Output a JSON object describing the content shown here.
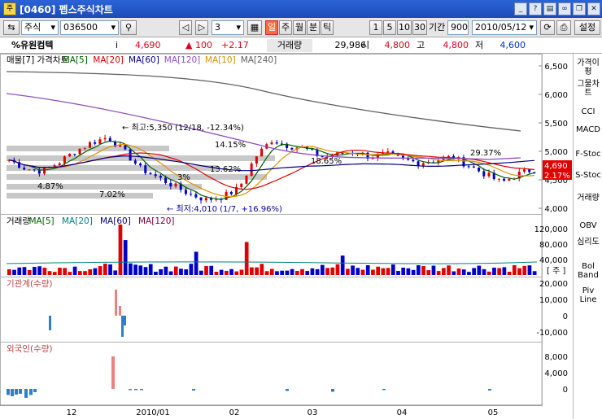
{
  "window": {
    "title": "[0460] 펩스주식차트",
    "app_icon": "주",
    "buttons": [
      "↓",
      "?",
      "?",
      "?",
      "?",
      "✕"
    ]
  },
  "toolbar": {
    "market": "주식",
    "code": "036500",
    "count": "3",
    "period_buttons": [
      "일",
      "주",
      "월",
      "분",
      "틱"
    ],
    "active_period": "일",
    "interval_buttons": [
      "1",
      "5",
      "10",
      "30"
    ],
    "range_label": "기간",
    "range_value": "900",
    "date": "2010/05/12",
    "settings_label": "설정"
  },
  "quote": {
    "name": "%유원컴텍",
    "i_label": "i",
    "price": "4,690",
    "change": "▲ 100",
    "rate": "+2.17",
    "volume_label": "거래량",
    "volume": "29,986",
    "open_label": "시",
    "open": "4,800",
    "high_label": "고",
    "high": "4,800",
    "low_label": "저",
    "low": "4,600"
  },
  "price_panel": {
    "legend": [
      "매물[7]",
      "가격차트",
      "MA[5]",
      "MA[20]",
      "MA[60]",
      "MA[120]",
      "MA[10]",
      "MA[240]"
    ],
    "legend_colors": [
      "#000000",
      "#000000",
      "#006000",
      "#e00000",
      "#000080",
      "#9050c0",
      "#e09000",
      "#606060"
    ],
    "y_ticks": [
      "6,500",
      "6,000",
      "5,500",
      "5,000",
      "4,500",
      "4,000"
    ],
    "max_label": "최고:5,350 (12/18, -12.34%)",
    "min_label": "최저:4,010 (1/7, +16.96%)",
    "pct_labels": [
      "14.15%",
      "29.37%",
      "4.87%",
      "7.02%",
      "13.62%",
      "3%",
      "18.65%"
    ],
    "last_price": "4,690",
    "last_rate": "2.17%"
  },
  "volume_panel": {
    "legend": [
      "거래량",
      "MA[5]",
      "MA[20]",
      "MA[60]",
      "MA[120]"
    ],
    "legend_colors": [
      "#000000",
      "#006000",
      "#008080",
      "#000080",
      "#800040"
    ],
    "y_ticks": [
      "120,000",
      "80,000",
      "40,000"
    ],
    "unit": "[ 주 ]"
  },
  "inst_panel": {
    "legend": "기관계(수량)",
    "y_ticks": [
      "20,000",
      "10,000",
      "0",
      "-10,000"
    ]
  },
  "foreign_panel": {
    "legend": "외국인(수량)",
    "y_ticks": [
      "8,000",
      "4,000",
      "0"
    ]
  },
  "x_axis": [
    "12",
    "2010/01",
    "02",
    "03",
    "04",
    "05"
  ],
  "sidebar": [
    "가격이평",
    "그물차트",
    "CCI",
    "MACD",
    "F-Stoc",
    "S-Stoc",
    "거래량",
    "OBV",
    "심리도",
    "Bol Band",
    "Piv Line"
  ]
}
